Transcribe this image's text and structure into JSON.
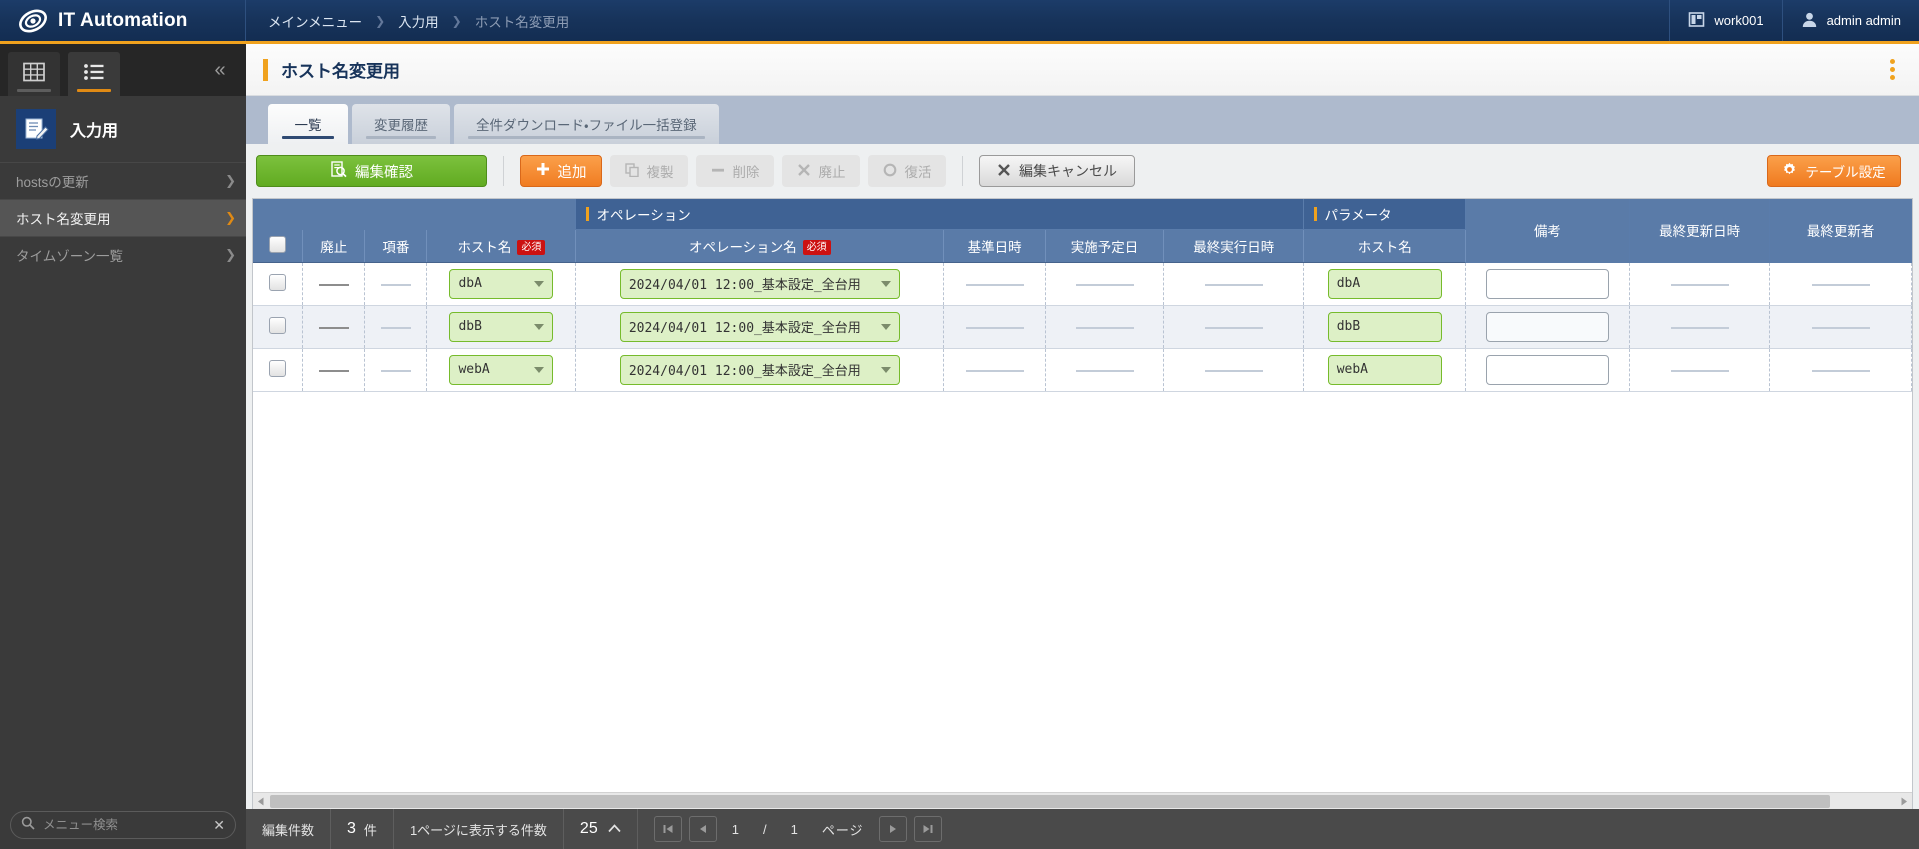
{
  "topbar": {
    "brand": "IT Automation",
    "brand_logo_icon": "swirl-logo-icon",
    "breadcrumb": [
      "メインメニュー",
      "入力用",
      "ホスト名変更用"
    ],
    "workspace_icon": "workspace-icon",
    "workspace": "work001",
    "user_icon": "user-avatar-icon",
    "user": "admin admin",
    "accent_color": "#f0a21e",
    "bg_color": "#17335a"
  },
  "sidebar": {
    "tab_grid_icon": "grid-view-icon",
    "tab_list_icon": "list-view-icon",
    "collapse_icon": "chevron-double-left-icon",
    "section_icon": "notepad-pencil-icon",
    "section_label": "入力用",
    "items": [
      {
        "label": "hostsの更新",
        "active": false
      },
      {
        "label": "ホスト名変更用",
        "active": true
      },
      {
        "label": "タイムゾーン一覧",
        "active": false
      }
    ],
    "search_icon": "search-icon",
    "search_clear_icon": "close-icon",
    "search_placeholder": "メニュー検索",
    "search_value": ""
  },
  "page": {
    "title": "ホスト名変更用",
    "kebab_icon": "more-vertical-icon"
  },
  "tabs": [
    {
      "label": "一覧",
      "active": true
    },
    {
      "label": "変更履歴",
      "active": false
    },
    {
      "label": "全件ダウンロード・ファイル一括登録",
      "active": false
    }
  ],
  "toolbar": {
    "confirm_edit": {
      "label": "編集確認",
      "icon": "document-search-icon",
      "style": "green",
      "disabled": false
    },
    "add": {
      "label": "追加",
      "icon": "plus-icon",
      "style": "orange",
      "disabled": false
    },
    "duplicate": {
      "label": "複製",
      "icon": "copy-icon",
      "style": "disabled",
      "disabled": true
    },
    "delete": {
      "label": "削除",
      "icon": "minus-icon",
      "style": "disabled",
      "disabled": true
    },
    "discontinue": {
      "label": "廃止",
      "icon": "x-icon",
      "style": "disabled",
      "disabled": true
    },
    "restore": {
      "label": "復活",
      "icon": "circle-icon",
      "style": "disabled",
      "disabled": true
    },
    "cancel_edit": {
      "label": "編集キャンセル",
      "icon": "x-icon",
      "style": "gray",
      "disabled": false
    },
    "table_settings": {
      "label": "テーブル設定",
      "icon": "gear-icon",
      "style": "orange",
      "disabled": false
    }
  },
  "table": {
    "group_headers": [
      {
        "label": "オペレーション",
        "accent": true
      },
      {
        "label": "パラメータ",
        "accent": true
      }
    ],
    "columns": [
      {
        "key": "check",
        "label": ""
      },
      {
        "key": "discontinue",
        "label": "廃止"
      },
      {
        "key": "seq",
        "label": "項番"
      },
      {
        "key": "hostname",
        "label": "ホスト名",
        "required": "必須"
      },
      {
        "key": "opname",
        "label": "オペレーション名",
        "required": "必須"
      },
      {
        "key": "basedate",
        "label": "基準日時"
      },
      {
        "key": "plandate",
        "label": "実施予定日"
      },
      {
        "key": "lastexec",
        "label": "最終実行日時"
      },
      {
        "key": "param_hostname",
        "label": "ホスト名"
      },
      {
        "key": "remarks",
        "label": "備考"
      },
      {
        "key": "updated_at",
        "label": "最終更新日時"
      },
      {
        "key": "updated_by",
        "label": "最終更新者"
      }
    ],
    "required_badge": "必須",
    "rows": [
      {
        "checked": false,
        "discontinue": "—",
        "seq": "—",
        "hostname": "dbA",
        "opname": "2024/04/01 12:00_基本設定_全台用",
        "basedate": "—",
        "plandate": "—",
        "lastexec": "—",
        "param_hostname": "dbA",
        "remarks": "",
        "updated_at": "—",
        "updated_by": "—"
      },
      {
        "checked": false,
        "discontinue": "—",
        "seq": "—",
        "hostname": "dbB",
        "opname": "2024/04/01 12:00_基本設定_全台用",
        "basedate": "—",
        "plandate": "—",
        "lastexec": "—",
        "param_hostname": "dbB",
        "remarks": "",
        "updated_at": "—",
        "updated_by": "—"
      },
      {
        "checked": false,
        "discontinue": "—",
        "seq": "—",
        "hostname": "webA",
        "opname": "2024/04/01 12:00_基本設定_全台用",
        "basedate": "—",
        "plandate": "—",
        "lastexec": "—",
        "param_hostname": "webA",
        "remarks": "",
        "updated_at": "—",
        "updated_by": "—"
      }
    ]
  },
  "footer": {
    "edit_count_label": "編集件数",
    "edit_count_value": "3",
    "edit_count_unit": "件",
    "per_page_label": "1ページに表示する件数",
    "per_page_value": "25",
    "per_page_caret_icon": "chevron-up-icon",
    "first_icon": "first-page-icon",
    "prev_icon": "prev-page-icon",
    "next_icon": "next-page-icon",
    "last_icon": "last-page-icon",
    "page_current": "1",
    "page_sep": "/",
    "page_total": "1",
    "page_unit": "ページ"
  }
}
